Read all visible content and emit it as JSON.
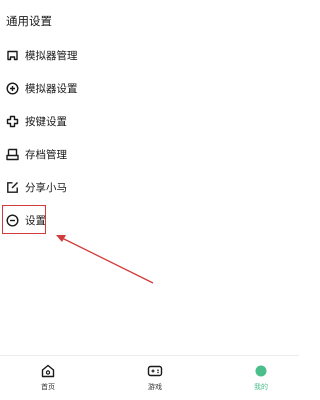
{
  "section": {
    "title": "通用设置"
  },
  "menu": {
    "items": [
      {
        "label": "模拟器管理",
        "icon": "gamepad-outline-icon"
      },
      {
        "label": "模拟器设置",
        "icon": "circle-plus-icon"
      },
      {
        "label": "按键设置",
        "icon": "cross-dpad-icon"
      },
      {
        "label": "存档管理",
        "icon": "archive-tray-icon"
      },
      {
        "label": "分享小马",
        "icon": "share-edit-icon"
      },
      {
        "label": "设置",
        "icon": "circle-minus-icon"
      }
    ]
  },
  "tabbar": {
    "tabs": [
      {
        "label": "首页",
        "icon": "home-icon",
        "active": false
      },
      {
        "label": "游戏",
        "icon": "gamepad-icon",
        "active": false
      },
      {
        "label": "我的",
        "icon": "profile-dot-icon",
        "active": true
      }
    ]
  },
  "colors": {
    "accent": "#4bbf8b",
    "annotation": "#d23b3b",
    "text": "#1a1a1a"
  }
}
